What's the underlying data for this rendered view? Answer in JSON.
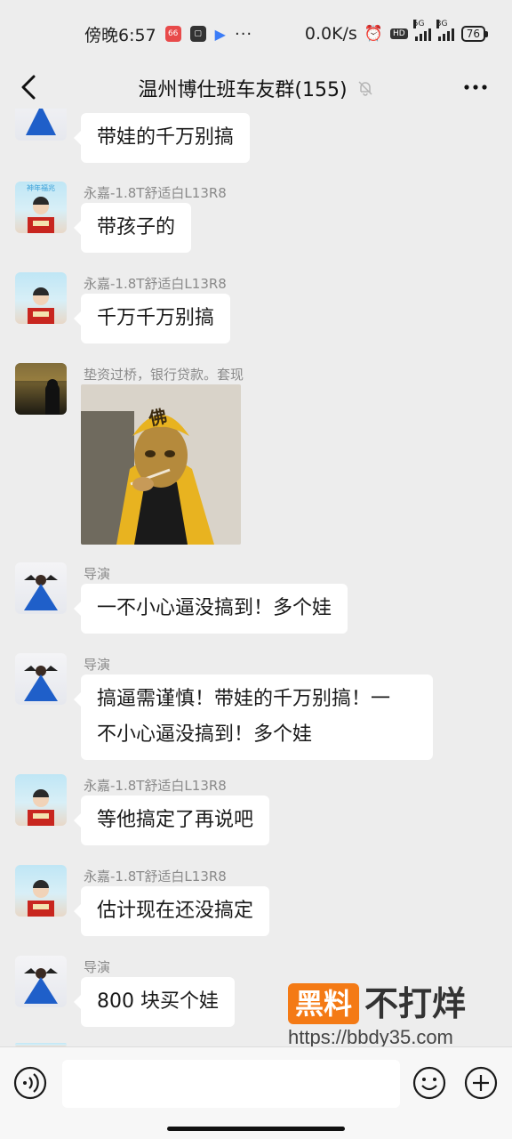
{
  "status_bar": {
    "time": "傍晚6:57",
    "app_badge": "66",
    "dots": "···",
    "speed": "0.0K/s",
    "hd": "HD",
    "net1": "5G",
    "net2": "3G",
    "battery": "76"
  },
  "header": {
    "title": "温州博仕班车友群(155)"
  },
  "messages": [
    {
      "sender": "",
      "text": "带娃的千万别搞"
    },
    {
      "sender": "永嘉-1.8T舒适白L13R8",
      "text": "带孩子的"
    },
    {
      "sender": "永嘉-1.8T舒适白L13R8",
      "text": "千万千万别搞"
    },
    {
      "sender": "垫资过桥，银行贷款。套现",
      "image_text": "佛"
    },
    {
      "sender": "导演",
      "text": "一不小心逼没搞到！多个娃"
    },
    {
      "sender": "导演",
      "line1": "搞逼需谨慎！带娃的千万别搞！一",
      "line2": "不小心逼没搞到！多个娃"
    },
    {
      "sender": "永嘉-1.8T舒适白L13R8",
      "text": "等他搞定了再说吧"
    },
    {
      "sender": "永嘉-1.8T舒适白L13R8",
      "text": "估计现在还没搞定"
    },
    {
      "sender": "导演",
      "text": "800 块买个娃"
    }
  ],
  "avatar_text": {
    "kid_banner": "神年福兆",
    "kid_shirt": "腾小王"
  },
  "watermark": {
    "box": "黑料",
    "text": "不打烊",
    "url": "https://bbdy35.com"
  },
  "input": {
    "placeholder": ""
  },
  "colors": {
    "background": "#ededed",
    "bubble": "#ffffff",
    "name": "#8a8a8a",
    "watermark_orange": "#f47a15"
  }
}
